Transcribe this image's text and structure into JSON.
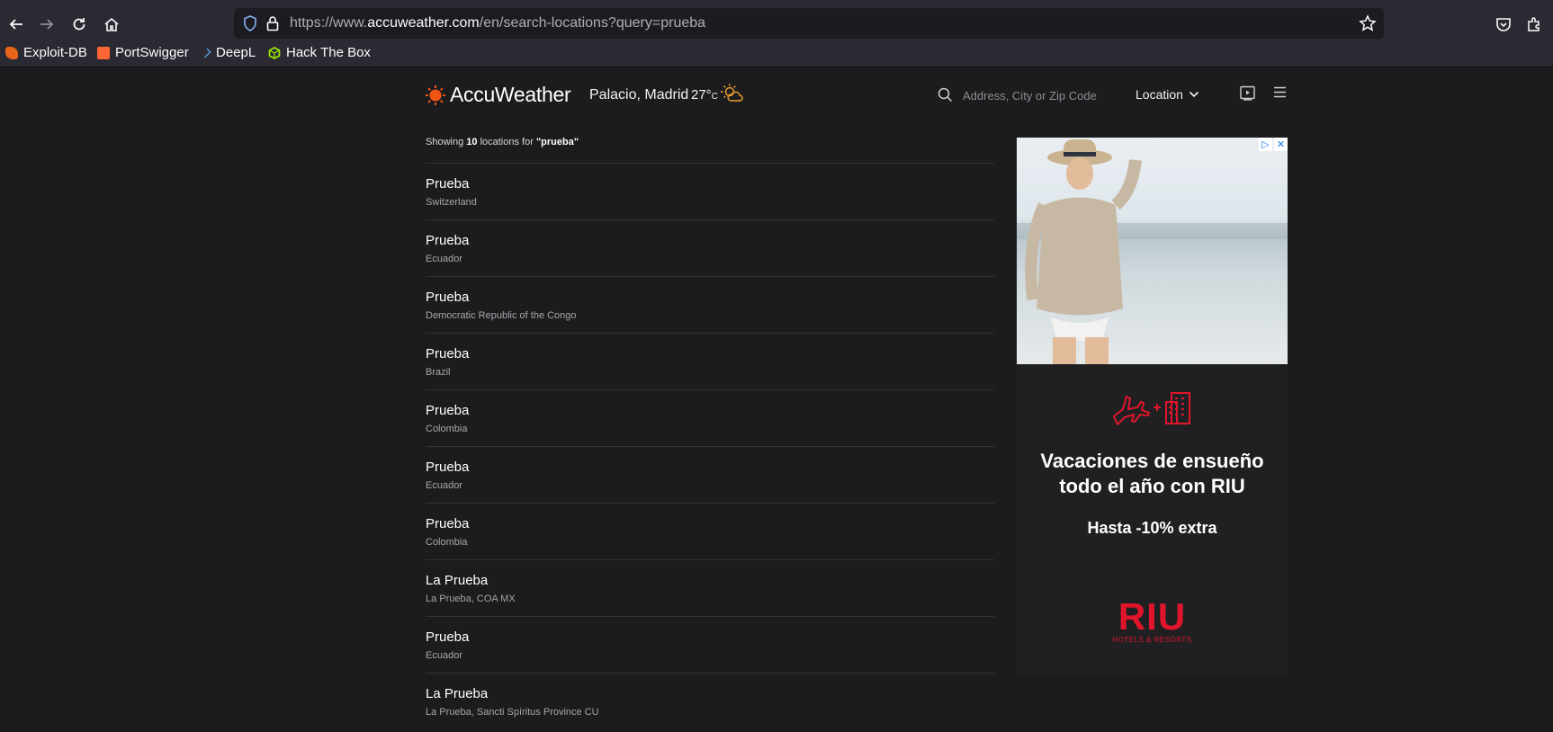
{
  "browser": {
    "url_prefix": "https://www.",
    "url_host": "accuweather.com",
    "url_path": "/en/search-locations?query=prueba",
    "bookmarks": [
      {
        "label": "Exploit-DB",
        "color": "#e8651a"
      },
      {
        "label": "PortSwigger",
        "color": "#ff6633"
      },
      {
        "label": "DeepL",
        "color": "#0f2b46"
      },
      {
        "label": "Hack The Box",
        "color": "#9fef00"
      }
    ]
  },
  "header": {
    "brand": "AccuWeather",
    "current_location": "Palacio, Madrid",
    "current_temp": "27°",
    "temp_unit": "C",
    "search_placeholder": "Address, City or Zip Code",
    "location_label": "Location",
    "accent_color": "#f05514"
  },
  "results": {
    "showing_prefix": "Showing ",
    "count": "10",
    "showing_mid": " locations for ",
    "query": "\"prueba\"",
    "items": [
      {
        "name": "Prueba",
        "sub": "Switzerland"
      },
      {
        "name": "Prueba",
        "sub": "Ecuador"
      },
      {
        "name": "Prueba",
        "sub": "Democratic Republic of the Congo"
      },
      {
        "name": "Prueba",
        "sub": "Brazil"
      },
      {
        "name": "Prueba",
        "sub": "Colombia"
      },
      {
        "name": "Prueba",
        "sub": "Ecuador"
      },
      {
        "name": "Prueba",
        "sub": "Colombia"
      },
      {
        "name": "La Prueba",
        "sub": "La Prueba, COA MX"
      },
      {
        "name": "Prueba",
        "sub": "Ecuador"
      },
      {
        "name": "La Prueba",
        "sub": "La Prueba, Sancti Spíritus Province CU"
      }
    ]
  },
  "ad": {
    "headline": "Vacaciones de ensueño todo el año con RIU",
    "subline": "Hasta -10% extra",
    "brand": "RIU",
    "tagline": "HOTELS & RESORTS",
    "brand_color": "#e0152b"
  }
}
